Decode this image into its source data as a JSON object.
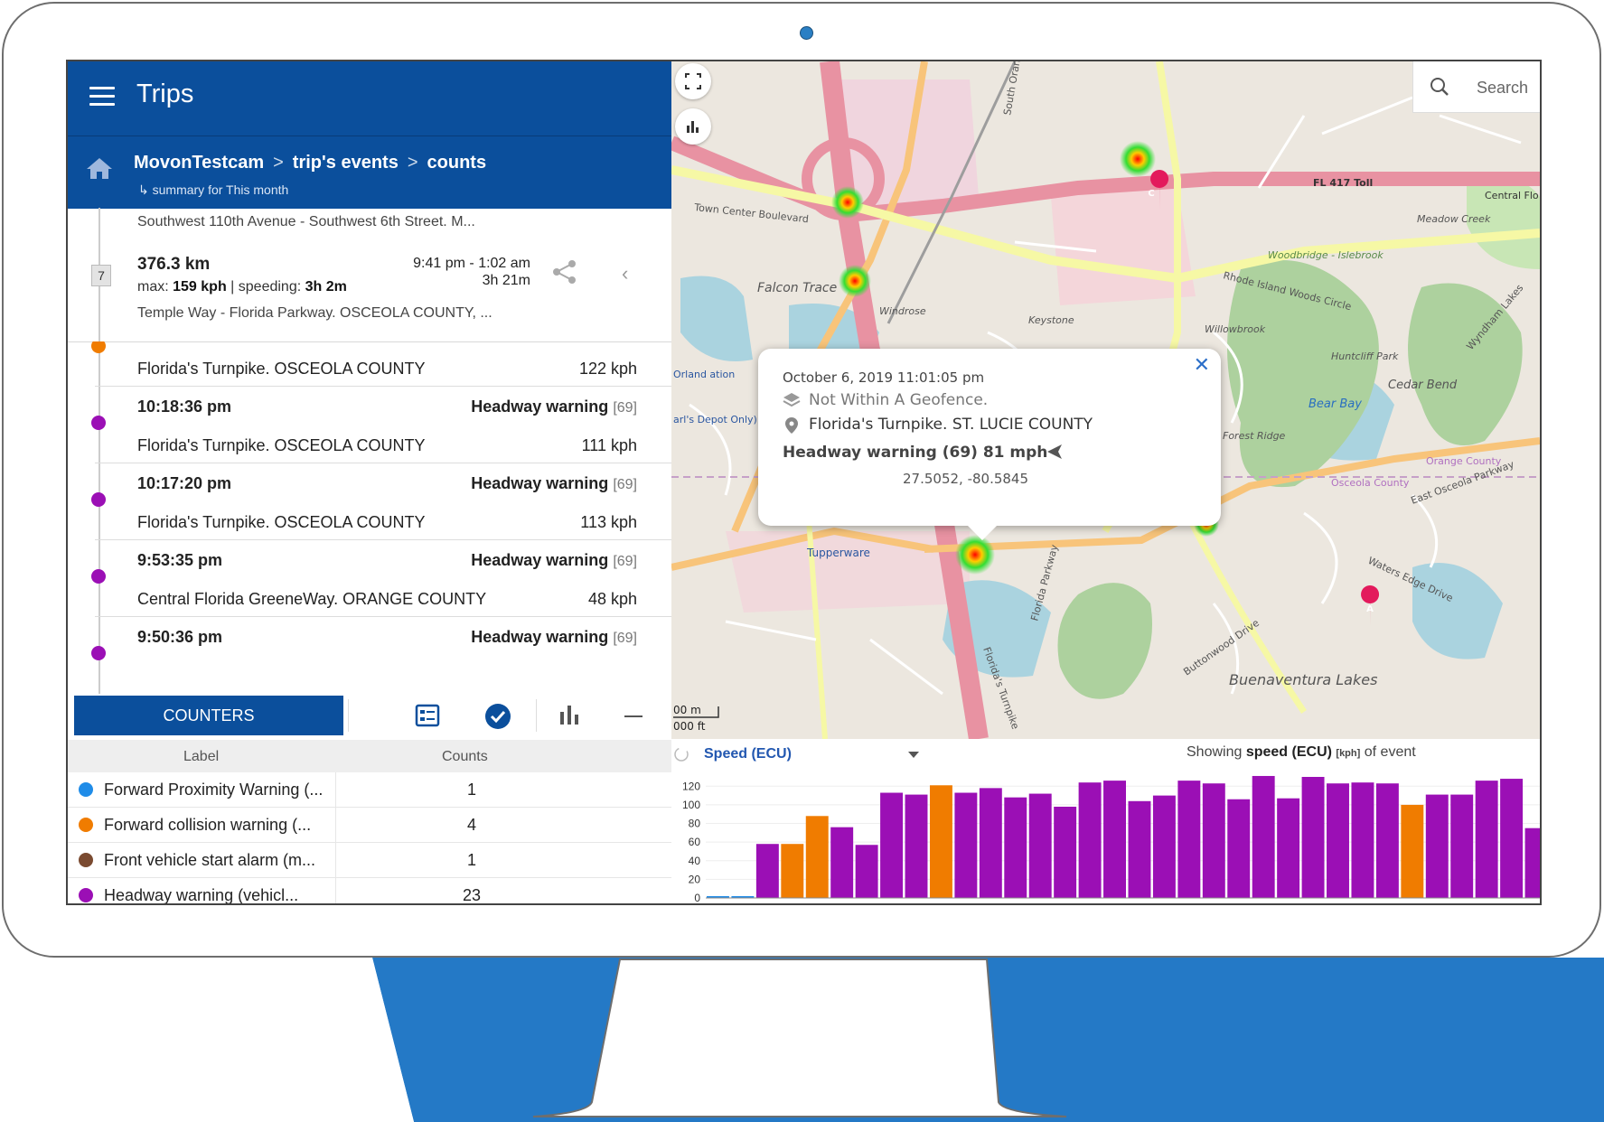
{
  "app": {
    "title": "Trips"
  },
  "breadcrumb": {
    "items": [
      "MovonTestcam",
      "trip's events",
      "counts"
    ],
    "sub": "↳ summary for This month"
  },
  "trip": {
    "from": "Southwest 110th Avenue - Southwest 6th Street. M...",
    "index": "7",
    "distance": "376.3 km",
    "max_label": "max:",
    "max_value": "159 kph",
    "speeding_label": "| speeding:",
    "speeding_value": "3h 2m",
    "time_range": "9:41 pm  -  1:02 am",
    "duration": "3h 21m",
    "to": "Temple Way - Florida Parkway. OSCEOLA COUNTY, ..."
  },
  "events": [
    {
      "time": "",
      "type": "",
      "code": "",
      "location": "Florida's Turnpike. OSCEOLA COUNTY",
      "speed": "122 kph",
      "color": "#f07c00"
    },
    {
      "time": "10:18:36 pm",
      "type": "Headway warning",
      "code": "[69]",
      "location": "Florida's Turnpike. OSCEOLA COUNTY",
      "speed": "111 kph",
      "color": "#9b0fb5"
    },
    {
      "time": "10:17:20 pm",
      "type": "Headway warning",
      "code": "[69]",
      "location": "Florida's Turnpike. OSCEOLA COUNTY",
      "speed": "113 kph",
      "color": "#9b0fb5"
    },
    {
      "time": "9:53:35 pm",
      "type": "Headway warning",
      "code": "[69]",
      "location": "Central Florida GreeneWay. ORANGE COUNTY",
      "speed": "48 kph",
      "color": "#9b0fb5"
    },
    {
      "time": "9:50:36 pm",
      "type": "Headway warning",
      "code": "[69]",
      "location": "",
      "speed": "",
      "color": "#9b0fb5"
    }
  ],
  "counters": {
    "button": "COUNTERS",
    "col_label": "Label",
    "col_counts": "Counts",
    "rows": [
      {
        "label": "Forward Proximity Warning (...",
        "count": "1",
        "color": "#1f8ce8"
      },
      {
        "label": "Forward collision warning (...",
        "count": "4",
        "color": "#f07c00"
      },
      {
        "label": "Front vehicle start alarm (m...",
        "count": "1",
        "color": "#7a4a30"
      },
      {
        "label": "Headway warning (vehicl...",
        "count": "23",
        "color": "#9b0fb5"
      }
    ]
  },
  "map": {
    "search_placeholder": "Search",
    "labels": {
      "fl417": "FL 417 Toll",
      "central_flo": "Central Flo",
      "town_center": "Town Center Boulevard",
      "falcon_trace": "Falcon Trace",
      "windrose": "Windrose",
      "keystone": "Keystone",
      "rhode_island": "Rhode Island Woods Circle",
      "woodbridge": "Woodbridge - Islebrook",
      "meadow_creek": "Meadow Creek",
      "willowbrook": "Willowbrook",
      "huntcliff": "Huntcliff Park",
      "cedar_bend": "Cedar Bend",
      "bear_bay": "Bear Bay",
      "forest_ridge": "Forest Ridge",
      "orange_county": "Orange County",
      "osceola_county": "Osceola County",
      "osceola_parkway": "East Osceola Parkway",
      "tupperware": "Tupperware",
      "waters_edge": "Waters Edge Drive",
      "buttonwood": "Buttonwood Drive",
      "buenaventura": "Buenaventura Lakes",
      "florida_turnpike": "Florida's Turnpike",
      "florida_parkway": "Florida Parkway",
      "south_orange": "South Orange",
      "scale_m": "00 m",
      "scale_ft": "000 ft",
      "wyndham": "Wyndham Lakes",
      "orland": "Orland ation",
      "depot": "arl's Depot Only)"
    },
    "markers": {
      "a": "A",
      "c": "C"
    },
    "popup": {
      "date": "October 6, 2019 11:01:05 pm",
      "geofence": "Not Within A Geofence.",
      "location": "Florida's Turnpike. ST. LUCIE COUNTY",
      "event": "Headway warning  (69)  81 mph",
      "coords": "27.5052, -80.5845"
    }
  },
  "chart_panel": {
    "select_label": "Speed (ECU)",
    "showing": "Showing",
    "metric": "speed (ECU)",
    "unit": "[kph]",
    "suffix": "of event"
  },
  "chart_data": {
    "type": "bar",
    "ylim": [
      0,
      130
    ],
    "yticks": [
      0,
      20,
      40,
      60,
      80,
      100,
      120
    ],
    "values": [
      0,
      0,
      58,
      58,
      88,
      76,
      57,
      113,
      111,
      121,
      113,
      118,
      108,
      112,
      98,
      124,
      126,
      104,
      110,
      126,
      123,
      106,
      131,
      107,
      130,
      123,
      124,
      123,
      100,
      111,
      111,
      126,
      128,
      75
    ],
    "colors": [
      "#1f8ce8",
      "#1f8ce8",
      "#9b0fb5",
      "#f07c00",
      "#f07c00",
      "#9b0fb5",
      "#9b0fb5",
      "#9b0fb5",
      "#9b0fb5",
      "#f07c00",
      "#9b0fb5",
      "#9b0fb5",
      "#9b0fb5",
      "#9b0fb5",
      "#9b0fb5",
      "#9b0fb5",
      "#9b0fb5",
      "#9b0fb5",
      "#9b0fb5",
      "#9b0fb5",
      "#9b0fb5",
      "#9b0fb5",
      "#9b0fb5",
      "#9b0fb5",
      "#9b0fb5",
      "#9b0fb5",
      "#9b0fb5",
      "#9b0fb5",
      "#f07c00",
      "#9b0fb5",
      "#9b0fb5",
      "#9b0fb5",
      "#9b0fb5",
      "#9b0fb5"
    ]
  },
  "colors": {
    "primary": "#0b4f9c",
    "stand": "#2479c6",
    "headway": "#9b0fb5",
    "collision": "#f07c00",
    "proximity": "#1f8ce8"
  }
}
